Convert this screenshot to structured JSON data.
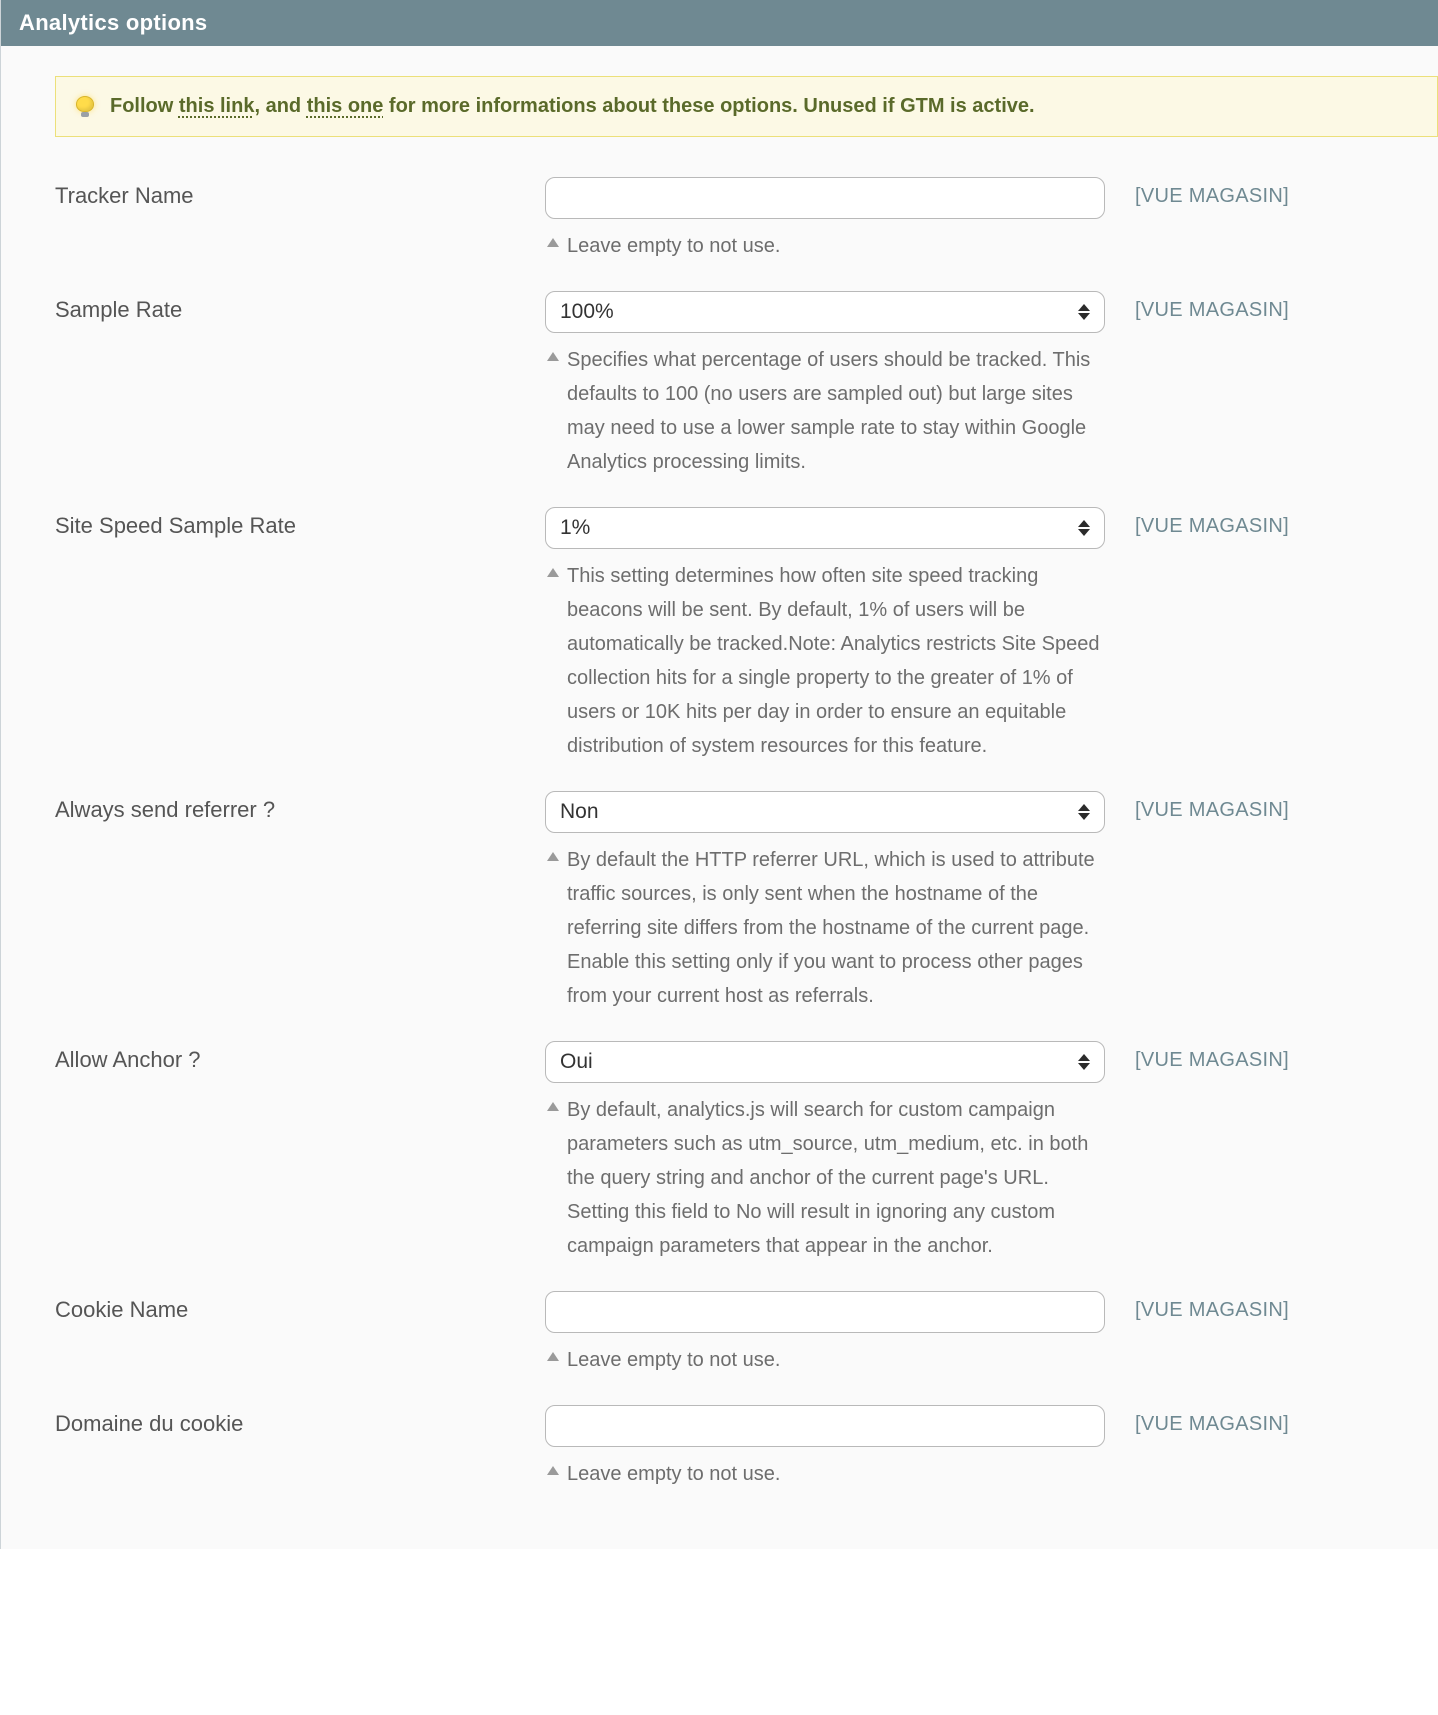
{
  "panel": {
    "title": "Analytics options"
  },
  "notice": {
    "prefix": "Follow ",
    "link1": "this link",
    "mid": ", and ",
    "link2": "this one",
    "suffix": " for more informations about these options. Unused if GTM is active."
  },
  "scope_label": "[VUE MAGASIN]",
  "fields": {
    "tracker_name": {
      "label": "Tracker Name",
      "type": "text",
      "value": "",
      "hint": "Leave empty to not use."
    },
    "sample_rate": {
      "label": "Sample Rate",
      "type": "select",
      "value": "100%",
      "hint": "Specifies what percentage of users should be tracked. This defaults to 100 (no users are sampled out) but large sites may need to use a lower sample rate to stay within Google Analytics processing limits."
    },
    "site_speed_rate": {
      "label": "Site Speed Sample Rate",
      "type": "select",
      "value": "1%",
      "hint": "This setting determines how often site speed tracking beacons will be sent. By default, 1% of users will be automatically be tracked.Note: Analytics restricts Site Speed collection hits for a single property to the greater of 1% of users or 10K hits per day in order to ensure an equitable distribution of system resources for this feature."
    },
    "always_send_referrer": {
      "label": "Always send referrer ?",
      "type": "select",
      "value": "Non",
      "hint": "By default the HTTP referrer URL, which is used to attribute traffic sources, is only sent when the hostname of the referring site differs from the hostname of the current page. Enable this setting only if you want to process other pages from your current host as referrals."
    },
    "allow_anchor": {
      "label": "Allow Anchor ?",
      "type": "select",
      "value": "Oui",
      "hint": "By default, analytics.js will search for custom campaign parameters such as utm_source, utm_medium, etc. in both the query string and anchor of the current page's URL. Setting this field to No will result in ignoring any custom campaign parameters that appear in the anchor."
    },
    "cookie_name": {
      "label": "Cookie Name",
      "type": "text",
      "value": "",
      "hint": "Leave empty to not use."
    },
    "cookie_domain": {
      "label": "Domaine du cookie",
      "type": "text",
      "value": "",
      "hint": "Leave empty to not use."
    }
  }
}
